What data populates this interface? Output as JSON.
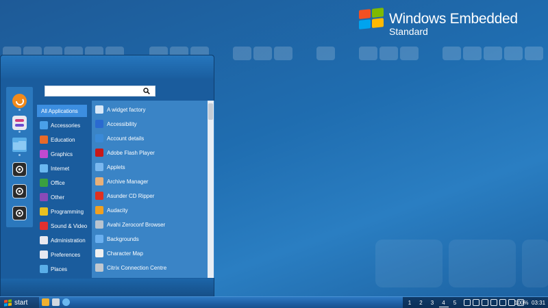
{
  "branding": {
    "title": "Windows Embedded",
    "subtitle": "Standard",
    "flag_colors": [
      "#f25022",
      "#7fba00",
      "#00a4ef",
      "#ffb900"
    ]
  },
  "search": {
    "value": "",
    "placeholder": "",
    "icon": "search-icon"
  },
  "favorites": [
    {
      "name": "firefox",
      "icon": "firefox-icon",
      "color": "#f08a1c"
    },
    {
      "name": "settings",
      "icon": "settings-toggle-icon",
      "color": "#e8e8f0"
    },
    {
      "name": "files",
      "icon": "folder-icon",
      "color": "#5aaee8"
    },
    {
      "name": "terminal",
      "icon": "screenshot-icon",
      "color": "#2a2a2a"
    },
    {
      "name": "logout",
      "icon": "power-icon",
      "color": "#2a2a2a"
    },
    {
      "name": "shutdown",
      "icon": "shutdown-icon",
      "color": "#2a2a2a"
    }
  ],
  "categories": [
    {
      "label": "All Applications",
      "icon": "",
      "color": "",
      "active": true
    },
    {
      "label": "Accessories",
      "icon": "accessories-icon",
      "color": "#4aa0e8"
    },
    {
      "label": "Education",
      "icon": "education-icon",
      "color": "#e86a2a"
    },
    {
      "label": "Graphics",
      "icon": "graphics-icon",
      "color": "#c04ad0"
    },
    {
      "label": "Internet",
      "icon": "internet-icon",
      "color": "#6ab8f0"
    },
    {
      "label": "Office",
      "icon": "office-icon",
      "color": "#3aa040"
    },
    {
      "label": "Other",
      "icon": "other-icon",
      "color": "#8a4ab8"
    },
    {
      "label": "Programming",
      "icon": "programming-icon",
      "color": "#e8c020"
    },
    {
      "label": "Sound & Video",
      "icon": "sound-video-icon",
      "color": "#e03030"
    },
    {
      "label": "Administration",
      "icon": "administration-icon",
      "color": "#e8e8f0"
    },
    {
      "label": "Preferences",
      "icon": "preferences-icon",
      "color": "#e8e8f0"
    },
    {
      "label": "Places",
      "icon": "places-icon",
      "color": "#5aaee8"
    }
  ],
  "apps": [
    {
      "label": "A widget factory",
      "icon": "widget-factory-icon",
      "color": "#d8e8f8"
    },
    {
      "label": "Accessibility",
      "icon": "accessibility-icon",
      "color": "#2a6ad0"
    },
    {
      "label": "Account details",
      "icon": "account-icon",
      "color": "#3a8ad8"
    },
    {
      "label": "Adobe Flash Player",
      "icon": "flash-icon",
      "color": "#c81818"
    },
    {
      "label": "Applets",
      "icon": "applets-icon",
      "color": "#7ab8f0"
    },
    {
      "label": "Archive Manager",
      "icon": "archive-icon",
      "color": "#e8b078"
    },
    {
      "label": "Asunder CD Ripper",
      "icon": "cd-ripper-icon",
      "color": "#e03020"
    },
    {
      "label": "Audacity",
      "icon": "audacity-icon",
      "color": "#f0a020"
    },
    {
      "label": "Avahi Zeroconf Browser",
      "icon": "avahi-icon",
      "color": "#b8c4d0"
    },
    {
      "label": "Backgrounds",
      "icon": "backgrounds-icon",
      "color": "#6ab0f0"
    },
    {
      "label": "Character Map",
      "icon": "character-map-icon",
      "color": "#f0f0f0"
    },
    {
      "label": "Citrix Connection Centre",
      "icon": "citrix-icon",
      "color": "#c0c8d0"
    }
  ],
  "taskbar": {
    "start_label": "start",
    "launchers": [
      {
        "icon": "file-manager-icon",
        "color": "#f0b030"
      },
      {
        "icon": "home-icon",
        "color": "#d0d8e0"
      },
      {
        "icon": "browser-icon",
        "color": "#6ab8f0"
      }
    ],
    "workspaces": [
      "1",
      "2",
      "3",
      "4",
      "5"
    ],
    "active_workspace": "4",
    "tray_icons": [
      "pen-icon",
      "music-icon",
      "link-icon",
      "chat-icon",
      "keyboard-a-icon",
      "info-icon",
      "battery-icon"
    ],
    "battery_label": "100%",
    "clock": "03:31"
  }
}
